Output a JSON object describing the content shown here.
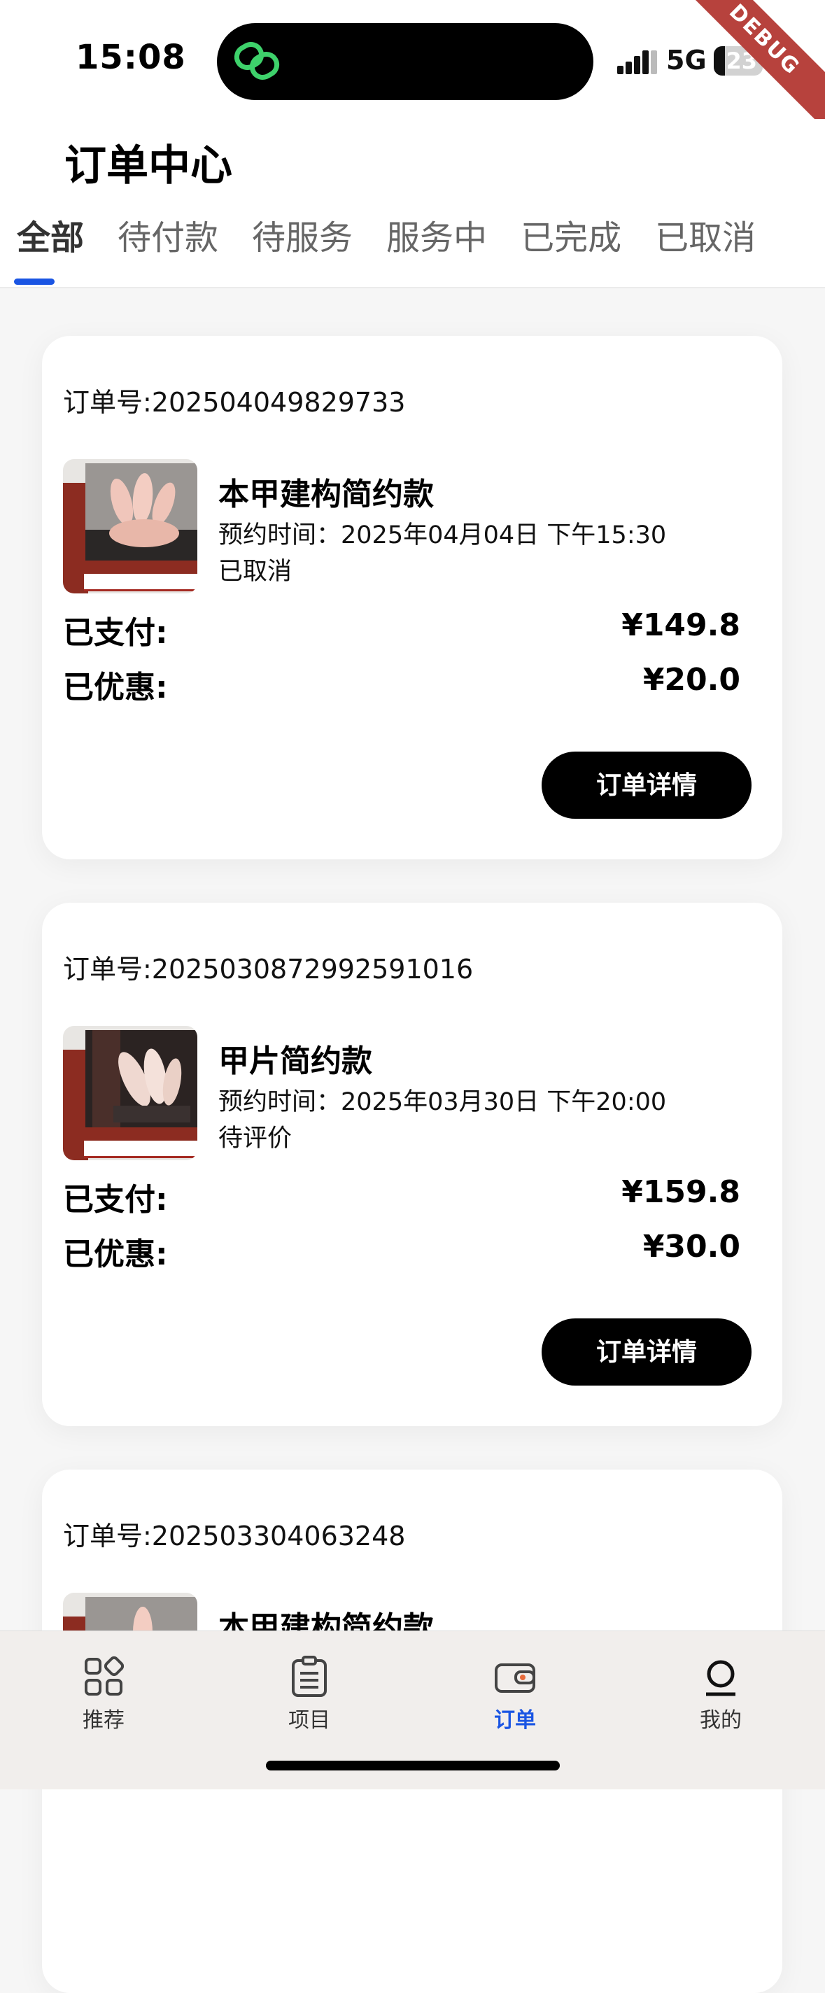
{
  "status_bar": {
    "time": "15:08",
    "network": "5G",
    "battery": "23",
    "battery_level": 0.23,
    "debug_label": "DEBUG"
  },
  "header": {
    "title": "订单中心",
    "tabs": [
      {
        "label": "全部"
      },
      {
        "label": "待付款"
      },
      {
        "label": "待服务"
      },
      {
        "label": "服务中"
      },
      {
        "label": "已完成"
      },
      {
        "label": "已取消"
      }
    ],
    "active_tab": "全部"
  },
  "orders": [
    {
      "order_no": "订单号:202504049829733",
      "title": "本甲建构简约款",
      "appointment_label": "预约时间：",
      "appointment_value": "2025年04月04日 下午15:30",
      "status": "已取消",
      "paid_label": "已支付:",
      "paid_value": "¥149.8",
      "discount_label": "已优惠:",
      "discount_value": "¥20.0",
      "detail_button": "订单详情"
    },
    {
      "order_no": "订单号:2025030872992591016",
      "title": "甲片简约款",
      "appointment_label": "预约时间：",
      "appointment_value": "2025年03月30日 下午20:00",
      "status": "待评价",
      "paid_label": "已支付:",
      "paid_value": "¥159.8",
      "discount_label": "已优惠:",
      "discount_value": "¥30.0",
      "detail_button": "订单详情"
    },
    {
      "order_no": "订单号:202503304063248",
      "title": "本甲建构简约款"
    }
  ],
  "bottom_nav": {
    "items": [
      {
        "label": "推荐",
        "icon": "grid-icon"
      },
      {
        "label": "项目",
        "icon": "clipboard-icon"
      },
      {
        "label": "订单",
        "icon": "wallet-icon"
      },
      {
        "label": "我的",
        "icon": "profile-icon"
      }
    ],
    "active": "订单"
  },
  "colors": {
    "accent": "#1a55e3",
    "button": "#000000",
    "thumb_red": "#8c2c21",
    "debug_ribbon": "#b7423d"
  }
}
